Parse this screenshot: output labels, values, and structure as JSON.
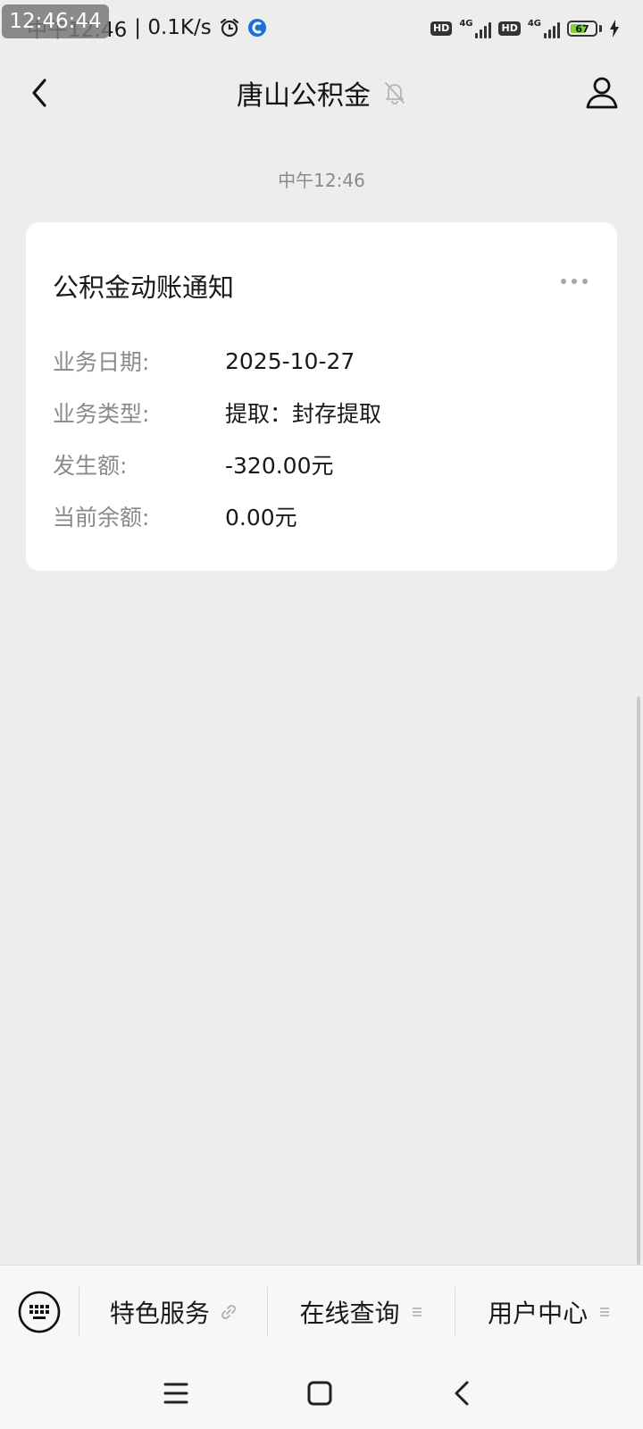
{
  "status_bar": {
    "time": "中午12:46",
    "speed": "| 0.1K/s",
    "overlay_clock": "12:46:44",
    "hd1": "HD",
    "sig1": "4G",
    "hd2": "HD",
    "sig2": "4G",
    "battery": "67",
    "battery_level": 0.67,
    "battery_color": "#7fd23b"
  },
  "nav": {
    "title": "唐山公积金"
  },
  "message": {
    "timestamp": "中午12:46"
  },
  "card": {
    "title": "公积金动账通知",
    "rows": [
      {
        "label": "业务日期:",
        "value": "2025-10-27"
      },
      {
        "label": "业务类型:",
        "value": "提取：封存提取"
      },
      {
        "label": "发生额:",
        "value": "-320.00元"
      },
      {
        "label": "当前余额:",
        "value": "0.00元"
      }
    ]
  },
  "menu": {
    "items": [
      {
        "label": "特色服务",
        "icon": "link-icon"
      },
      {
        "label": "在线查询",
        "icon": "menu-lines-icon"
      },
      {
        "label": "用户中心",
        "icon": "menu-lines-icon"
      }
    ]
  },
  "icons": {
    "back": "chevron-left-icon",
    "mute": "bell-off-icon",
    "profile": "user-icon",
    "more": "more-dots-icon",
    "keyboard": "keyboard-icon",
    "sys_menu": "menu-icon",
    "sys_home": "home-square-icon",
    "sys_back": "back-chevron-icon"
  }
}
